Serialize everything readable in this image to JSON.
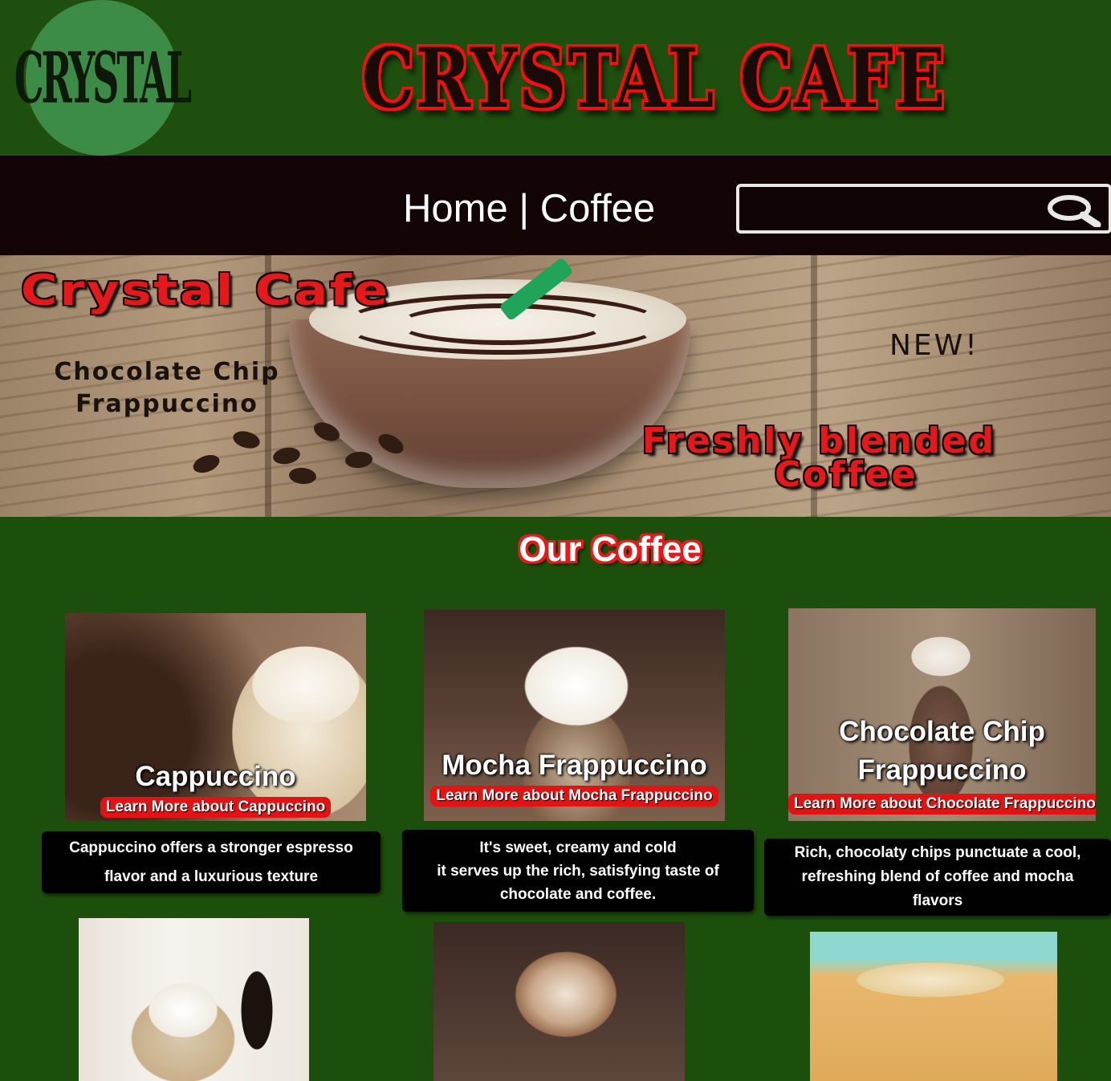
{
  "header": {
    "logo_text": "CRYSTAL",
    "site_title": "CRYSTAL CAFE"
  },
  "nav": {
    "home": "Home",
    "separator": "|",
    "coffee": "Coffee"
  },
  "search": {
    "placeholder": "",
    "value": "",
    "icon": "search-icon"
  },
  "banner": {
    "title": "Crystal Cafe",
    "product": "Chocolate Chip\nFrappuccino",
    "badge": "NEW!",
    "tagline_line1": "Freshly blended",
    "tagline_line2": "Coffee"
  },
  "section": {
    "heading": "Our Coffee"
  },
  "products": [
    {
      "name": "Cappuccino",
      "learn_more": "Learn More about Cappuccino",
      "description": "Cappuccino offers a stronger espresso\nflavor and a luxurious texture"
    },
    {
      "name": "Mocha Frappuccino",
      "learn_more": "Learn More about Mocha Frappuccino",
      "description": "It's sweet, creamy and cold\nit serves up the rich, satisfying taste of\nchocolate and coffee."
    },
    {
      "name": "Chocolate Chip\nFrappuccino",
      "learn_more": "Learn More about Chocolate Frappuccino",
      "description": "Rich, chocolaty chips punctuate a cool,\nrefreshing blend of coffee and mocha\nflavors"
    }
  ],
  "colors": {
    "page_bg": "#1d4f0c",
    "navbar_bg": "#130506",
    "accent_red": "#e11313",
    "logo_circle": "#3c8b47"
  }
}
